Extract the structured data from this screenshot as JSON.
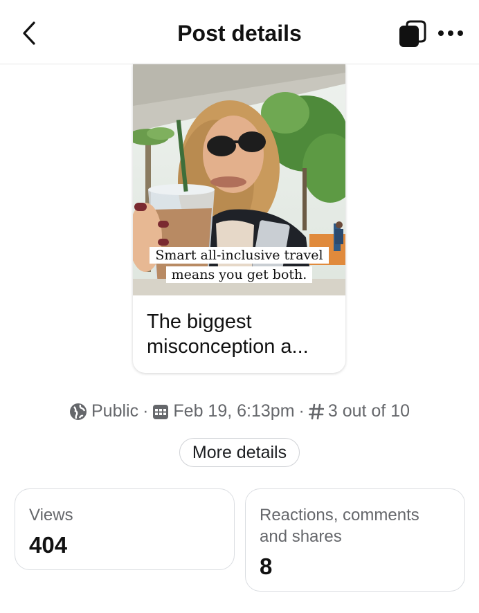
{
  "header": {
    "title": "Post details",
    "back_icon": "chevron-left-icon",
    "actions": [
      "copy-icon",
      "more-horizontal-icon"
    ]
  },
  "post": {
    "overlay_line1": "Smart all-inclusive travel",
    "overlay_line2": "means you get both.",
    "caption": "The biggest misconception a..."
  },
  "meta": {
    "visibility": "Public",
    "separator": "·",
    "date": "Feb 19, 6:13pm",
    "position": "3 out of 10"
  },
  "more_details_label": "More details",
  "stats": {
    "views_label": "Views",
    "views_value": "404",
    "reactions_label": "Reactions, comments and shares",
    "reactions_value": "8"
  }
}
